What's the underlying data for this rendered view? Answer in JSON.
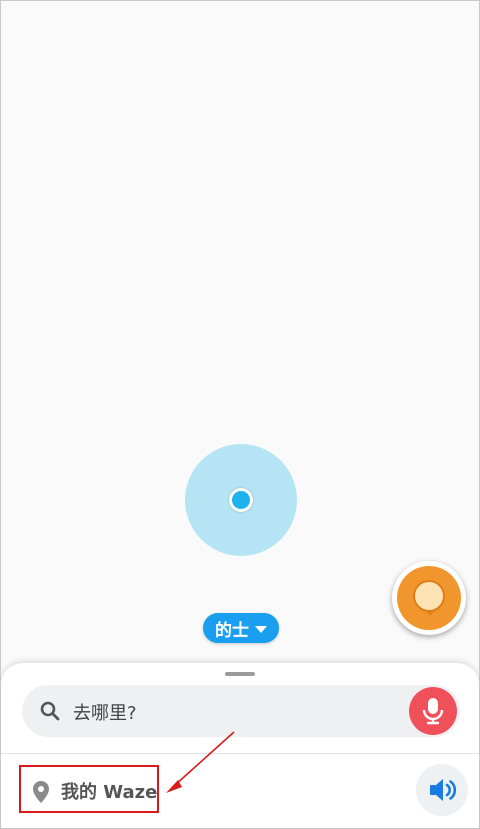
{
  "map": {
    "mode_label": "的士"
  },
  "bottom_sheet": {
    "search_placeholder": "去哪里?",
    "my_waze_label": "我的 Waze"
  },
  "colors": {
    "accent_blue": "#1a9ef0",
    "mic_red": "#f0505a",
    "report_orange": "#f0962c",
    "highlight_red": "#d81a1a"
  },
  "icons": [
    "location-dot-icon",
    "caret-down-icon",
    "report-icon",
    "search-icon",
    "microphone-icon",
    "pin-icon",
    "speaker-icon"
  ]
}
